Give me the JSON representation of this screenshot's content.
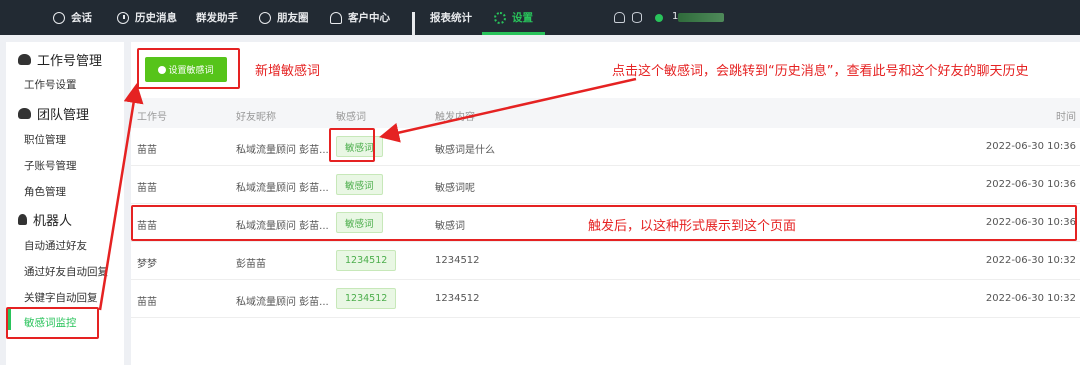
{
  "nav": {
    "items": [
      {
        "label": "会话",
        "icon": "chat-icon"
      },
      {
        "label": "历史消息",
        "icon": "clock-icon"
      },
      {
        "label": "群发助手",
        "icon": "none"
      },
      {
        "label": "朋友圈",
        "icon": "moments-icon"
      },
      {
        "label": "客户中心",
        "icon": "user-icon"
      },
      {
        "label": "报表统计",
        "icon": "bar-chart-icon"
      },
      {
        "label": "设置",
        "icon": "gear-icon"
      }
    ],
    "active": "设置",
    "user_label": "1"
  },
  "sidebar": {
    "sections": [
      {
        "title": "工作号管理",
        "items": [
          "工作号设置"
        ]
      },
      {
        "title": "团队管理",
        "items": [
          "职位管理",
          "子账号管理",
          "角色管理"
        ]
      },
      {
        "title": "机器人",
        "items": [
          "自动通过好友",
          "通过好友自动回复",
          "关键字自动回复",
          "敏感词监控"
        ]
      }
    ],
    "active_item": "敏感词监控"
  },
  "main": {
    "add_button": "设置敏感词",
    "columns": [
      "工作号",
      "好友昵称",
      "敏感词",
      "触发内容",
      "时间"
    ],
    "rows": [
      {
        "account": "苗苗",
        "friend": "私域流量顾问 彭苗...",
        "word": "敏感词",
        "content": "敏感词是什么",
        "time": "2022-06-30 10:36"
      },
      {
        "account": "苗苗",
        "friend": "私域流量顾问 彭苗...",
        "word": "敏感词",
        "content": "敏感词呢",
        "time": "2022-06-30 10:36"
      },
      {
        "account": "苗苗",
        "friend": "私域流量顾问 彭苗...",
        "word": "敏感词",
        "content": "敏感词",
        "time": "2022-06-30 10:36"
      },
      {
        "account": "梦梦",
        "friend": "彭苗苗",
        "word": "1234512",
        "content": "1234512",
        "time": "2022-06-30 10:32"
      },
      {
        "account": "苗苗",
        "friend": "私域流量顾问 彭苗...",
        "word": "1234512",
        "content": "1234512",
        "time": "2022-06-30 10:32"
      }
    ]
  },
  "annotations": {
    "add_word": "新增敏感词",
    "click_word": "点击这个敏感词，会跳转到“历史消息”，查看此号和这个好友的聊天历史",
    "trigger_note": "触发后，以这种形式展示到这个页面",
    "color": "#e52222"
  },
  "colors": {
    "accent": "#29c35b",
    "button": "#56c41a",
    "topbar": "#222a33"
  }
}
